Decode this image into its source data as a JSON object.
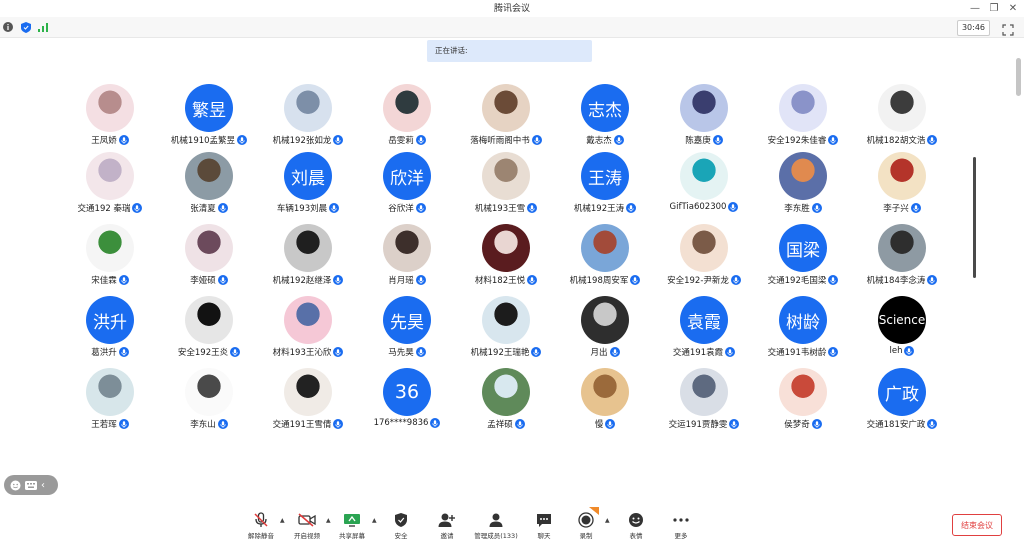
{
  "window": {
    "title": "腾讯会议",
    "minimize_icon": "minimize-icon",
    "restore_icon": "restore-icon",
    "close_icon": "close-icon"
  },
  "statusbar": {
    "timer": "30:46"
  },
  "speaking": {
    "label": "正在讲话:"
  },
  "participants": [
    {
      "name": "王凤娇",
      "type": "img",
      "colors": [
        "#f4dfe3",
        "#b78d8d"
      ]
    },
    {
      "name": "机械1910孟繁昱",
      "type": "text",
      "text": "繁昱"
    },
    {
      "name": "机械192张如龙",
      "type": "img",
      "colors": [
        "#d7e1ee",
        "#7d8fa8"
      ]
    },
    {
      "name": "岳雯莉",
      "type": "img",
      "colors": [
        "#f3d6d6",
        "#2f3b3f"
      ]
    },
    {
      "name": "落梅听雨阁中书",
      "type": "img",
      "colors": [
        "#e6d3c3",
        "#6b4b37"
      ]
    },
    {
      "name": "戴志杰",
      "type": "text",
      "text": "志杰"
    },
    {
      "name": "陈嘉庚",
      "type": "img",
      "colors": [
        "#b9c6e8",
        "#3a3e6f"
      ]
    },
    {
      "name": "安全192朱佳睿",
      "type": "img",
      "colors": [
        "#e1e4f7",
        "#8a93c9"
      ]
    },
    {
      "name": "机械182胡文浩",
      "type": "img",
      "colors": [
        "#f2f2f2",
        "#3c3c3c"
      ]
    },
    {
      "name": "交通192 秦瑞",
      "type": "img",
      "colors": [
        "#f3e6ea",
        "#c2b2c8"
      ]
    },
    {
      "name": "张清夏",
      "type": "img",
      "colors": [
        "#8c9ba5",
        "#5b4a3a"
      ]
    },
    {
      "name": "车辆193刘晨",
      "type": "text",
      "text": "刘晨"
    },
    {
      "name": "谷欣洋",
      "type": "text",
      "text": "欣洋"
    },
    {
      "name": "机械193王雪",
      "type": "img",
      "colors": [
        "#e8ddd3",
        "#9c8572"
      ]
    },
    {
      "name": "机械192王涛",
      "type": "text",
      "text": "王涛"
    },
    {
      "name": "GifTia602300",
      "type": "img",
      "colors": [
        "#e4f3f3",
        "#1aa5b7"
      ]
    },
    {
      "name": "李东胜",
      "type": "img",
      "colors": [
        "#5b6fa8",
        "#e08a4f"
      ]
    },
    {
      "name": "李子兴",
      "type": "img",
      "colors": [
        "#f3e2c4",
        "#b4342a"
      ]
    },
    {
      "name": "宋佳霖",
      "type": "img",
      "colors": [
        "#f5f5f5",
        "#3c8f3c"
      ]
    },
    {
      "name": "李娅硕",
      "type": "img",
      "colors": [
        "#efe2e6",
        "#6c4a5c"
      ]
    },
    {
      "name": "机械192赵继泽",
      "type": "img",
      "colors": [
        "#c8c8c8",
        "#1f1f1f"
      ]
    },
    {
      "name": "肖月瑶",
      "type": "img",
      "colors": [
        "#dcd0c9",
        "#3d2f2b"
      ]
    },
    {
      "name": "材料182王悦",
      "type": "img",
      "colors": [
        "#5a1c1f",
        "#e9d6d2"
      ]
    },
    {
      "name": "机械198周安军",
      "type": "img",
      "colors": [
        "#7aa6d8",
        "#a24b3a"
      ]
    },
    {
      "name": "安全192-尹新龙",
      "type": "img",
      "colors": [
        "#f3e0d2",
        "#7b5b48"
      ]
    },
    {
      "name": "交通192毛国梁",
      "type": "text",
      "text": "国梁"
    },
    {
      "name": "机械184李念涛",
      "type": "img",
      "colors": [
        "#8e9aa3",
        "#2e2e2e"
      ]
    },
    {
      "name": "葛洪升",
      "type": "text",
      "text": "洪升"
    },
    {
      "name": "安全192王炎",
      "type": "img",
      "colors": [
        "#e6e6e6",
        "#121212"
      ]
    },
    {
      "name": "材料193王沁欣",
      "type": "img",
      "colors": [
        "#f5c8d6",
        "#5870a8"
      ]
    },
    {
      "name": "马先昊",
      "type": "text",
      "text": "先昊"
    },
    {
      "name": "机械192王瑞艳",
      "type": "img",
      "colors": [
        "#d8e6ee",
        "#1c1c1c"
      ]
    },
    {
      "name": "月出",
      "type": "img",
      "colors": [
        "#2e2e2e",
        "#c8c8c8"
      ]
    },
    {
      "name": "交通191袁霞",
      "type": "text",
      "text": "袁霞"
    },
    {
      "name": "交通191韦树龄",
      "type": "text",
      "text": "树龄"
    },
    {
      "name": "leh",
      "type": "black",
      "text": "Science"
    },
    {
      "name": "王若珲",
      "type": "img",
      "colors": [
        "#d7e6ea",
        "#7d8e98"
      ]
    },
    {
      "name": "李东山",
      "type": "img",
      "colors": [
        "#fafafa",
        "#4a4a4a"
      ]
    },
    {
      "name": "交通191王雪倩",
      "type": "img",
      "colors": [
        "#f0ebe6",
        "#222222"
      ]
    },
    {
      "name": "176****9836",
      "type": "num",
      "text": "36"
    },
    {
      "name": "孟祥硕",
      "type": "img",
      "colors": [
        "#5f8a5a",
        "#d8e8ef"
      ]
    },
    {
      "name": "慢",
      "type": "img",
      "colors": [
        "#e7c38f",
        "#9b6a3b"
      ]
    },
    {
      "name": "交运191贾静雯",
      "type": "img",
      "colors": [
        "#d9dee6",
        "#5e6a80"
      ]
    },
    {
      "name": "侯梦奇",
      "type": "img",
      "colors": [
        "#f8e0d8",
        "#c94a3a"
      ]
    },
    {
      "name": "交通181安广政",
      "type": "text",
      "text": "广政"
    }
  ],
  "toolbar": {
    "unmute": "解除静音",
    "video": "开启视频",
    "share": "共享屏幕",
    "security": "安全",
    "invite": "邀请",
    "members": "管理成员(133)",
    "chat": "聊天",
    "record": "录制",
    "emoji": "表情",
    "more": "更多",
    "end": "结束会议"
  },
  "colors": {
    "accent": "#1a6cf0",
    "danger": "#e04040",
    "speaking_bg": "#dde9fb"
  }
}
